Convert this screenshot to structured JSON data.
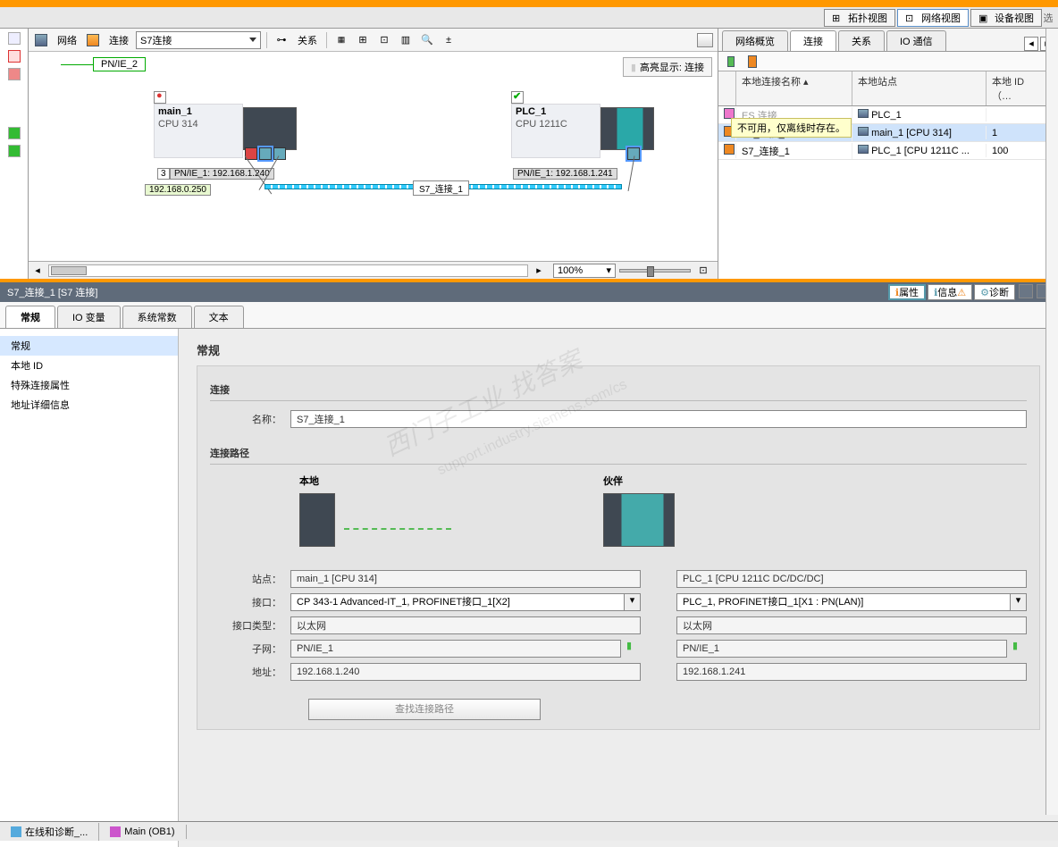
{
  "view_buttons": {
    "topology": "拓扑视图",
    "network": "网络视图",
    "device": "设备视图",
    "extra": "选"
  },
  "net_toolbar": {
    "network_label": "网络",
    "connection_label": "连接",
    "select_value": "S7连接",
    "relation_label": "关系",
    "highlight_label": "高亮显示: 连接"
  },
  "pnie_tag": "PN/IE_2",
  "device1": {
    "name": "main_1",
    "cpu": "CPU 314"
  },
  "device2": {
    "name": "PLC_1",
    "cpu": "CPU 1211C"
  },
  "port_num": "3",
  "ip1_label": "PN/IE_1: 192.168.1.240",
  "ip2_label": "PN/IE_1: 192.168.1.241",
  "ip_gw": "192.168.0.250",
  "conn_label": "S7_连接_1",
  "zoom_value": "100%",
  "right_tabs": {
    "overview": "网络概览",
    "connections": "连接",
    "relations": "关系",
    "io": "IO 通信"
  },
  "conn_table": {
    "col_name": "本地连接名称",
    "col_station": "本地站点",
    "col_id": "本地 ID（…",
    "rows": [
      {
        "name": "ES 连接",
        "station": "PLC_1",
        "id": ""
      },
      {
        "name": "S7_连接_1",
        "station": "main_1 [CPU 314]",
        "id": "1"
      },
      {
        "name": "S7_连接_1",
        "station": "PLC_1 [CPU 1211C ...",
        "id": "100"
      }
    ],
    "tooltip": "不可用，仅离线时存在。"
  },
  "prop_title": "S7_连接_1 [S7 连接]",
  "prop_right_tabs": {
    "properties": "属性",
    "info": "信息",
    "diag": "诊断"
  },
  "prop_tabs": {
    "general": "常规",
    "io": "IO 变量",
    "consts": "系统常数",
    "text": "文本"
  },
  "prop_side": {
    "general": "常规",
    "local_id": "本地 ID",
    "special": "特殊连接属性",
    "addr_detail": "地址详细信息"
  },
  "section": {
    "h1": "常规",
    "conn_h": "连接",
    "name_label": "名称：",
    "name_value": "S7_连接_1",
    "path_h": "连接路径",
    "local_h": "本地",
    "partner_h": "伙伴",
    "station_label": "站点：",
    "iface_label": "接口：",
    "iftype_label": "接口类型：",
    "subnet_label": "子网：",
    "addr_label": "地址：",
    "local": {
      "station": "main_1 [CPU 314]",
      "iface": "CP 343-1 Advanced-IT_1, PROFINET接口_1[X2]",
      "iftype": "以太网",
      "subnet": "PN/IE_1",
      "addr": "192.168.1.240"
    },
    "partner": {
      "station": "PLC_1 [CPU 1211C DC/DC/DC]",
      "iface": "PLC_1, PROFINET接口_1[X1 : PN(LAN)]",
      "iftype": "以太网",
      "subnet": "PN/IE_1",
      "addr": "192.168.1.241"
    },
    "find_btn": "查找连接路径"
  },
  "watermark1": "西门子工业 找答案",
  "watermark2": "support.industry.siemens.com/cs",
  "bottom": {
    "diag": "在线和诊断_...",
    "main": "Main (OB1)"
  },
  "icons": {
    "search": "🔍",
    "plus": "+",
    "arrow_l": "◂",
    "arrow_r": "▸",
    "arrow_d": "▾",
    "check": "✔"
  }
}
